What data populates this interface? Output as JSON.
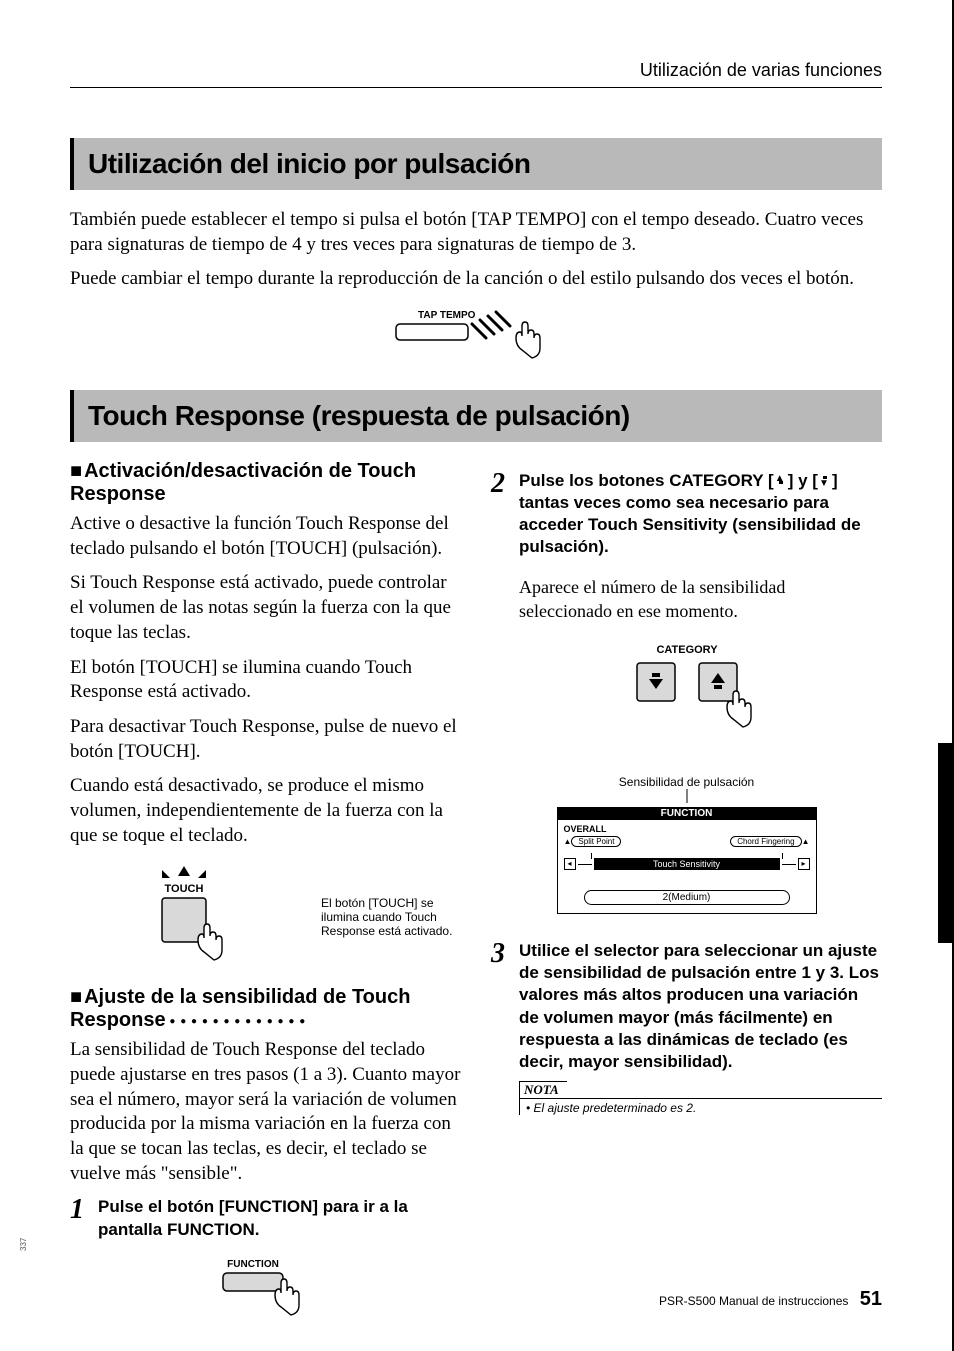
{
  "header": {
    "breadcrumb": "Utilización de varias funciones"
  },
  "section1": {
    "title": "Utilización del inicio por pulsación",
    "p1": "También puede establecer el tempo si pulsa el botón [TAP TEMPO] con el tempo deseado. Cuatro veces para signaturas de tiempo de 4 y tres veces para signaturas de tiempo de 3.",
    "p2": "Puede cambiar el tempo durante la reproducción de la canción o del estilo pulsando dos veces el botón.",
    "fig_label": "TAP TEMPO"
  },
  "section2": {
    "title": "Touch Response (respuesta de pulsación)",
    "left": {
      "h1": "Activación/desactivación de Touch Response",
      "p1": "Active o desactive la función Touch Response del teclado pulsando el botón [TOUCH] (pulsación).",
      "p2": "Si Touch Response está activado, puede controlar el volumen de las notas según la fuerza con la que toque las teclas.",
      "p3": "El botón [TOUCH] se ilumina cuando Touch Response está activado.",
      "p4": "Para desactivar Touch Response, pulse de nuevo el botón [TOUCH].",
      "p5": "Cuando está desactivado, se produce el mismo volumen, independientemente de la fuerza con la que se toque el teclado.",
      "fig_label": "TOUCH",
      "fig_caption": "El botón [TOUCH] se ilumina cuando Touch Response está activado.",
      "h2": "Ajuste de la sensibilidad de Touch Response",
      "p6": "La sensibilidad de Touch Response del teclado puede ajustarse en tres pasos (1 a 3). Cuanto mayor sea el número, mayor será la variación de volumen producida por la misma variación en la fuerza con la que se tocan las teclas, es decir, el teclado se vuelve más \"sensible\".",
      "step1_text": "Pulse el botón [FUNCTION] para ir a la pantalla FUNCTION.",
      "step1_fig_label": "FUNCTION"
    },
    "right": {
      "step2_text_a": "Pulse los botones CATEGORY [",
      "step2_text_b": "] y [",
      "step2_text_c": "] tantas veces como sea necesario para acceder Touch Sensitivity (sensibilidad de pulsación).",
      "step2_body": "Aparece el número de la sensibilidad seleccionado en ese momento.",
      "fig_label": "CATEGORY",
      "lcd_caption": "Sensibilidad de pulsación",
      "lcd": {
        "banner": "FUNCTION",
        "overall": "OVERALL",
        "split": "Split Point",
        "chord": "Chord Fingering",
        "touch_sens": "Touch Sensitivity",
        "value": "2(Medium)"
      },
      "step3_text": "Utilice el selector para seleccionar un ajuste de sensibilidad de pulsación entre 1 y 3. Los valores más altos producen una variación de volumen mayor (más fácilmente) en respuesta a las dinámicas de teclado (es decir, mayor sensibilidad).",
      "note_title": "NOTA",
      "note_body": "• El ajuste predeterminado es 2."
    }
  },
  "footer": {
    "product": "PSR-S500  Manual de instrucciones",
    "page": "51",
    "side": "337"
  }
}
